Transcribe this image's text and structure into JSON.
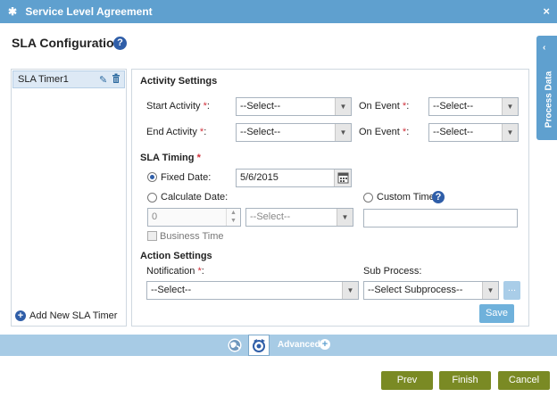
{
  "window": {
    "title": "Service Level Agreement",
    "close": "×"
  },
  "page": {
    "title": "SLA Configuration",
    "help": "?"
  },
  "timers": {
    "items": [
      {
        "label": "SLA Timer1"
      }
    ],
    "edit_icon": "✎",
    "delete_icon": "🗑",
    "add_label": "Add New SLA Timer",
    "add_icon": "+"
  },
  "activity_settings": {
    "title": "Activity Settings",
    "start_activity": {
      "label": "Start Activity ",
      "required": "*",
      "suffix": ":",
      "value": "--Select--"
    },
    "start_event": {
      "label": "On Event ",
      "required": "*",
      "suffix": ":",
      "value": "--Select--"
    },
    "end_activity": {
      "label": "End Activity ",
      "required": "*",
      "suffix": ":",
      "value": "--Select--"
    },
    "end_event": {
      "label": "On Event ",
      "required": "*",
      "suffix": ":",
      "value": "--Select--"
    }
  },
  "sla_timing": {
    "title": "SLA Timing ",
    "required": "*",
    "fixed_date": {
      "label": "Fixed Date:",
      "value": "5/6/2015",
      "selected": true
    },
    "calculate_date": {
      "label": "Calculate Date:",
      "number": "0",
      "unit": "--Select--",
      "selected": false
    },
    "custom_time": {
      "label": "Custom Time:",
      "help": "?",
      "value": ""
    },
    "business_time": {
      "label": "Business Time"
    }
  },
  "action_settings": {
    "title": "Action Settings",
    "notification": {
      "label": "Notification ",
      "required": "*",
      "suffix": ":",
      "value": "--Select--"
    },
    "sub_process": {
      "label": "Sub Process:",
      "value": "--Select Subprocess--",
      "browse": "..."
    },
    "save": "Save"
  },
  "process_data_tab": {
    "label": "Process Data",
    "arrow": "‹"
  },
  "bottom_toolbar": {
    "advanced": "Advanced",
    "advanced_icon": "+"
  },
  "footer": {
    "prev": "Prev",
    "finish": "Finish",
    "cancel": "Cancel"
  },
  "colors": {
    "header": "#5fa0cf",
    "strip": "#a7cbe5",
    "nav_button": "#7a8a24",
    "accent": "#2f5ea8"
  }
}
